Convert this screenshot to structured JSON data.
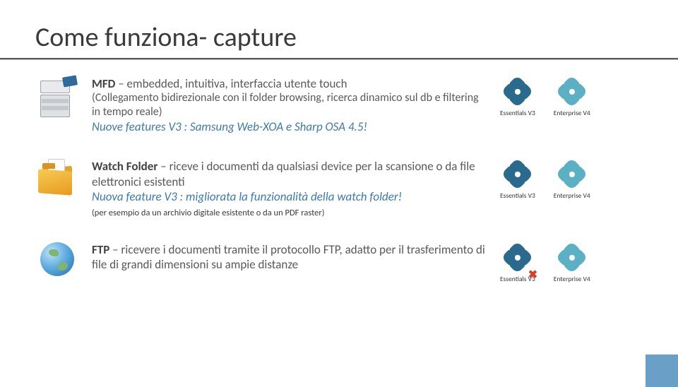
{
  "title": "Come funziona- capture",
  "sections": {
    "mfd": {
      "lead": "MFD",
      "text": " – embedded, intuitiva, interfaccia utente touch",
      "sub": "(Collegamento bidirezionale con il folder browsing, ricerca dinamico sul db e filtering in tempo reale)",
      "italic": "Nuove features V3 : Samsung Web-XOA e Sharp OSA 4.5!"
    },
    "watch": {
      "lead": "Watch Folder",
      "text": " – riceve i documenti da qualsiasi device per la scansione o da file elettronici esistenti",
      "italic": "Nuova feature V3 : migliorata la funzionalità della watch folder!",
      "note": "(per esempio da un archivio digitale esistente o da un PDF raster)"
    },
    "ftp": {
      "lead": "FTP",
      "text": " – ricevere i documenti tramite il protocollo FTP, adatto per il trasferimento di file di grandi dimensioni su ampie distanze"
    }
  },
  "badges": {
    "essentials": "Essentials V3",
    "enterprise": "Enterprise V4"
  }
}
